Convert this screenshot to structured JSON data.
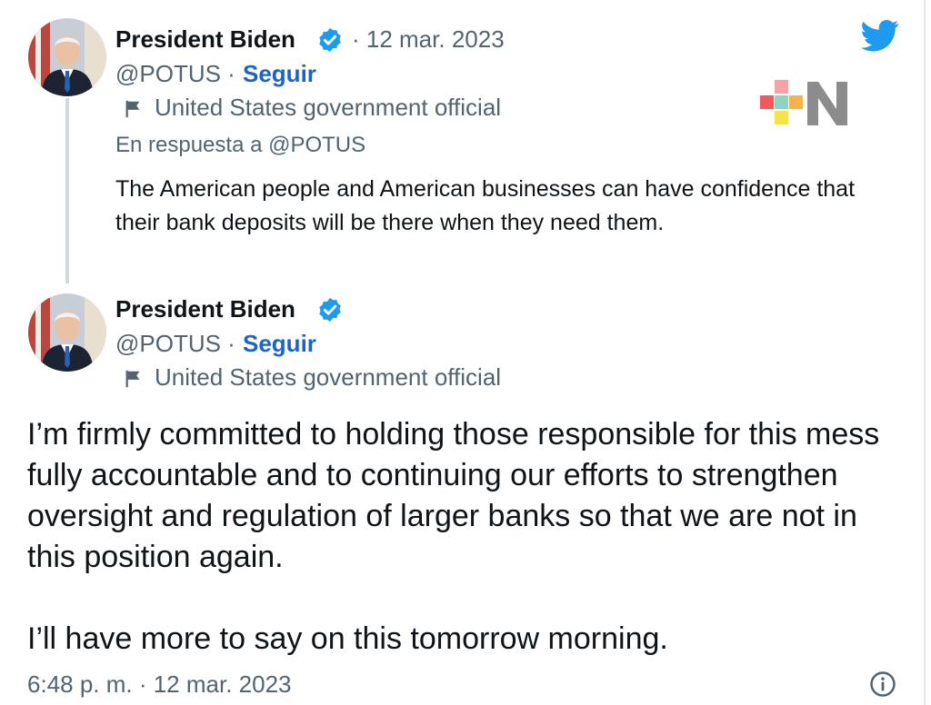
{
  "parent_tweet": {
    "author_name": "President Biden",
    "date": "· 12 mar. 2023",
    "handle": "@POTUS ·",
    "follow_label": "Seguir",
    "account_label": "United States government official",
    "reply_to": "En respuesta a @POTUS",
    "text": "The American people and American businesses can have confidence that their bank deposits will be there when they need them."
  },
  "main_tweet": {
    "author_name": "President Biden",
    "handle": "@POTUS ·",
    "follow_label": "Seguir",
    "account_label": "United States government official",
    "paragraph_1": "I’m firmly committed to holding those responsible for this mess fully accountable and to continuing our efforts to strengthen oversight and regulation of larger banks so that we are not in this position again.",
    "paragraph_2": "I’ll have more to say on this tomorrow morning.",
    "timestamp": "6:48 p. m. · 12 mar. 2023"
  },
  "icons": {
    "brand": "twitter-bird-icon",
    "verified": "verified-badge-icon",
    "flag": "flag-icon",
    "info": "info-icon",
    "watermark": "plus-n-logo"
  },
  "colors": {
    "link_blue": "#1d63c9",
    "twitter_blue": "#1d9bf0",
    "muted_text": "#536471"
  }
}
